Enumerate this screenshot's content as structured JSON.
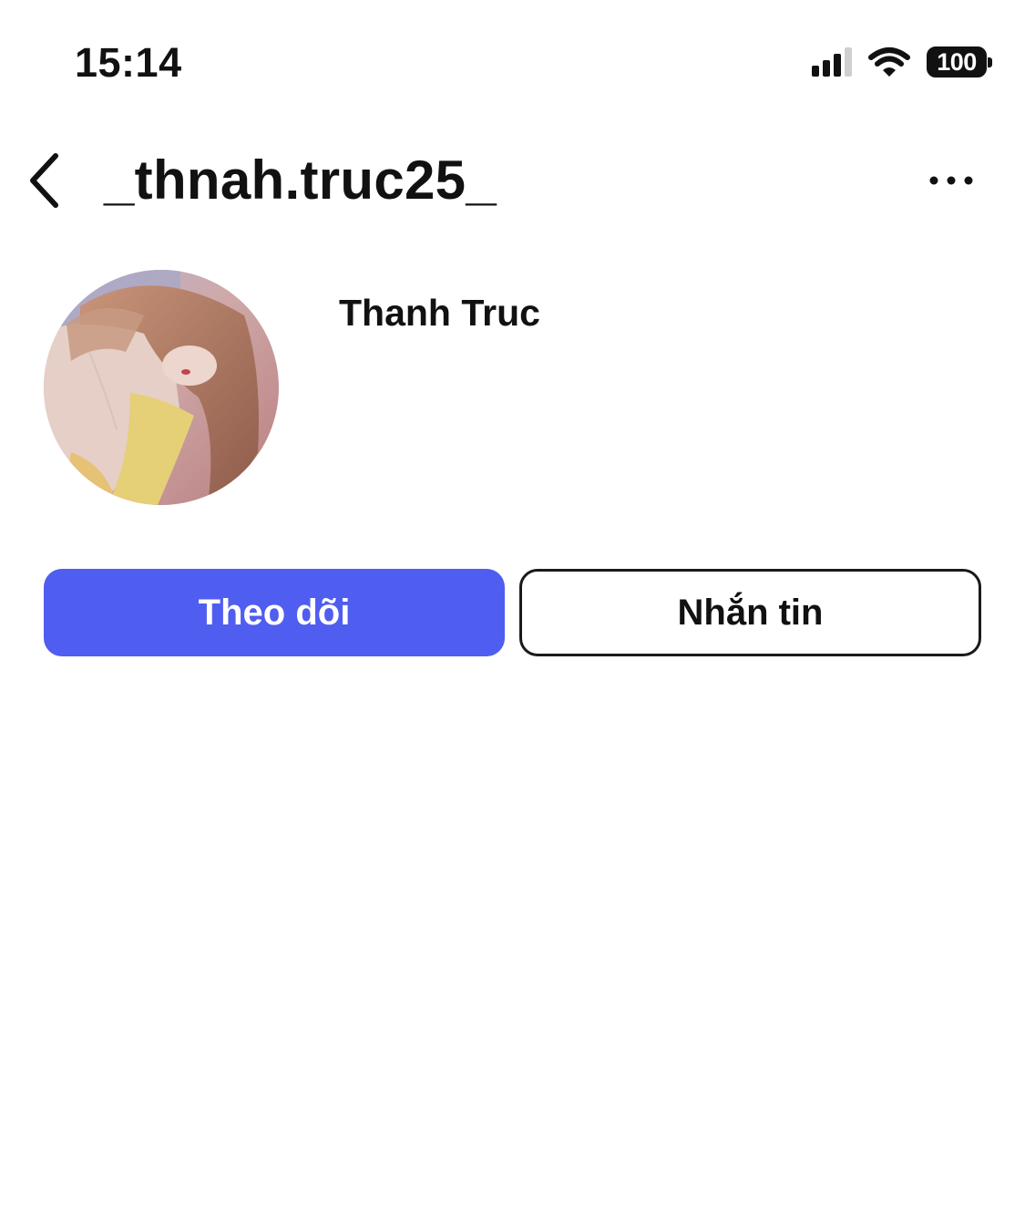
{
  "status_bar": {
    "time": "15:14",
    "battery": "100",
    "icons": [
      "cellular-signal-icon",
      "wifi-icon",
      "battery-icon"
    ]
  },
  "header": {
    "username": "_thnah.truc25_",
    "back_icon": "chevron-left-icon",
    "more_icon": "more-horizontal-icon"
  },
  "profile": {
    "display_name": "Thanh Truc"
  },
  "actions": {
    "follow_label": "Theo dõi",
    "message_label": "Nhắn tin"
  },
  "colors": {
    "follow_button": "#4f5df0",
    "text": "#111111",
    "background": "#ffffff"
  }
}
